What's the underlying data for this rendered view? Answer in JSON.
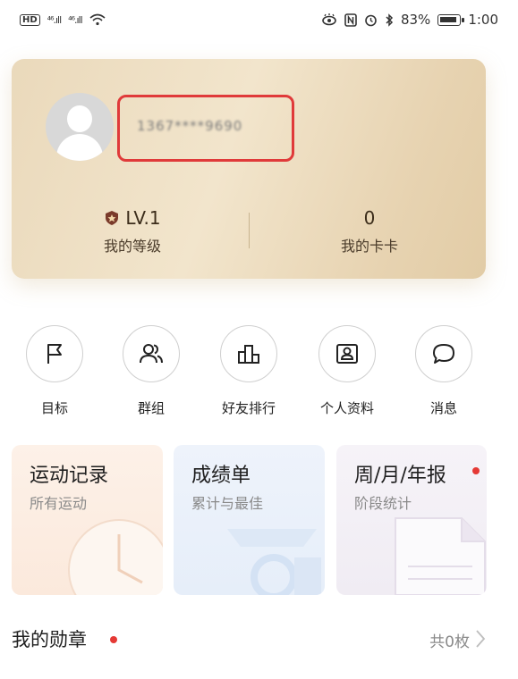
{
  "status_bar": {
    "left_badge": "HD",
    "signal1": "⁴⁶.ıll",
    "signal2": "⁴⁶.ıll",
    "battery": "83%",
    "time": "1:00"
  },
  "profile": {
    "phone_masked": "1367****9690",
    "level_value": "LV.1",
    "level_label": "我的等级",
    "cards_value": "0",
    "cards_label": "我的卡卡"
  },
  "quick_actions": [
    {
      "label": "目标",
      "icon": "flag-icon"
    },
    {
      "label": "群组",
      "icon": "group-icon"
    },
    {
      "label": "好友排行",
      "icon": "ranking-icon"
    },
    {
      "label": "个人资料",
      "icon": "profile-card-icon"
    },
    {
      "label": "消息",
      "icon": "message-bubble-icon"
    }
  ],
  "tiles": [
    {
      "title": "运动记录",
      "subtitle": "所有运动",
      "color": "#fbe9dc"
    },
    {
      "title": "成绩单",
      "subtitle": "累计与最佳",
      "color": "#e6eef9"
    },
    {
      "title": "周/月/年报",
      "subtitle": "阶段统计",
      "color": "#f0ecf3"
    }
  ],
  "medals": {
    "title": "我的勋章",
    "count": "共0枚"
  },
  "colors": {
    "accent_red": "#e53935",
    "card_gold": "#ead9bb"
  }
}
